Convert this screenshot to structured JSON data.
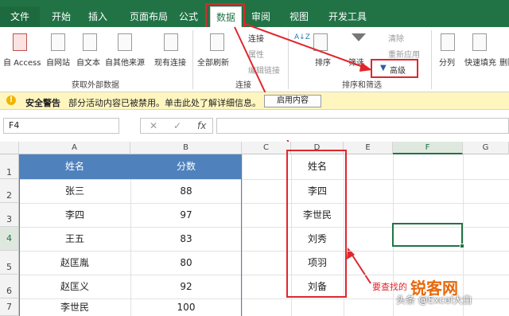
{
  "window": {
    "file_name": "查找数据.xlsx"
  },
  "tabs": [
    "文件",
    "开始",
    "插入",
    "页面布局",
    "公式",
    "数据",
    "审阅",
    "视图",
    "开发工具"
  ],
  "ribbon": {
    "get_external": [
      "自 Access",
      "自网站",
      "自文本",
      "自其他来源",
      "现有连接"
    ],
    "get_external_group": "获取外部数据",
    "refresh": "全部刷新",
    "conn_items": [
      "连接",
      "属性",
      "编辑链接"
    ],
    "conn_group": "连接",
    "sort": "排序",
    "filter": "筛选",
    "filter_items": [
      "清除",
      "重新应用",
      "高级"
    ],
    "sort_group": "排序和筛选",
    "split": "分列",
    "flash_fill": "快速填充",
    "remove_dup": "删除"
  },
  "warning": {
    "title": "安全警告",
    "message": "部分活动内容已被禁用。单击此处了解详细信息。",
    "button": "启用内容"
  },
  "formula_bar": {
    "name_box": "F4",
    "cancel": "✕",
    "confirm": "✓",
    "fx": "fx",
    "value": ""
  },
  "columns": [
    "A",
    "B",
    "C",
    "D",
    "E",
    "F",
    "G"
  ],
  "rows": [
    "1",
    "2",
    "3",
    "4",
    "5",
    "6",
    "7"
  ],
  "table_a": {
    "headers": [
      "姓名",
      "分数"
    ],
    "names": [
      "张三",
      "李四",
      "王五",
      "赵匡胤",
      "赵匡义",
      "李世民"
    ],
    "scores": [
      "88",
      "97",
      "83",
      "80",
      "92",
      "100"
    ]
  },
  "col_d": [
    "姓名",
    "李四",
    "李世民",
    "刘秀",
    "项羽",
    "刘备"
  ],
  "annotation": "要查找的",
  "watermark": {
    "top": "锐客网",
    "bottom": "头条 @Excel大白"
  }
}
